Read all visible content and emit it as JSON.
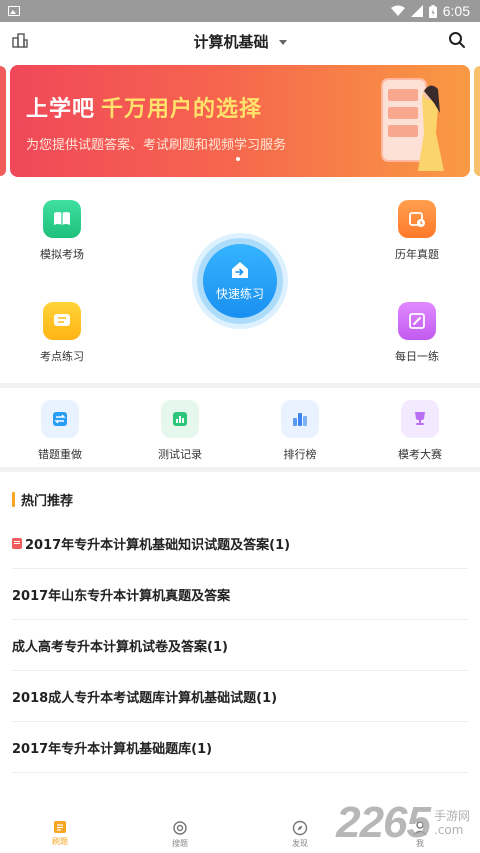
{
  "status_bar": {
    "time": "6:05"
  },
  "header": {
    "title": "计算机基础"
  },
  "banner": {
    "title_part1": "上学吧",
    "title_part2": "千万用户的选择",
    "subtitle": "为您提供试题答案、考试刷题和视频学习服务"
  },
  "grid": {
    "mock_exam": "模拟考场",
    "past_exams": "历年真题",
    "topic_practice": "考点练习",
    "daily_practice": "每日一练",
    "quick_practice": "快速练习"
  },
  "tools": {
    "wrong_redo": "错题重做",
    "test_records": "测试记录",
    "leaderboard": "排行榜",
    "contest": "模考大赛"
  },
  "hot": {
    "title": "热门推荐",
    "items": [
      "2017年专升本计算机基础知识试题及答案(1)",
      "2017年山东专升本计算机真题及答案",
      "成人高考专升本计算机试卷及答案(1)",
      "2018成人专升本考试题库计算机基础试题(1)",
      "2017年专升本计算机基础题库(1)"
    ]
  },
  "nav": {
    "practice": "刷题",
    "search": "搜题",
    "discover": "发现",
    "me": "我"
  },
  "watermark": {
    "number": "2265",
    "line1": "手游网",
    "line2": ".com"
  },
  "colors": {
    "accent": "#f5a623",
    "quick_blue": "#1a8ff0"
  }
}
